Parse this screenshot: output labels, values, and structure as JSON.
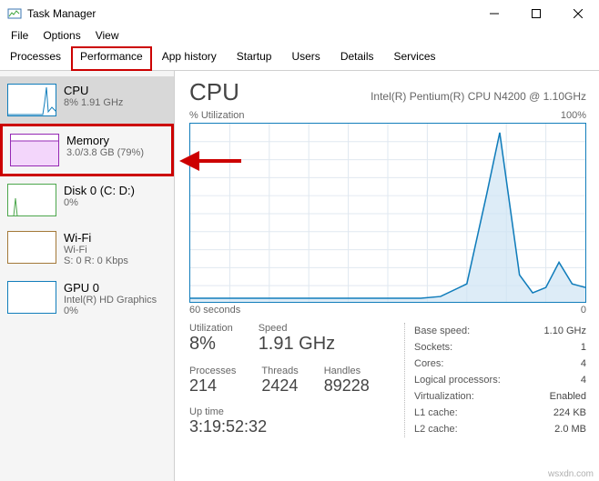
{
  "window": {
    "title": "Task Manager"
  },
  "menu": {
    "file": "File",
    "options": "Options",
    "view": "View"
  },
  "tabs": {
    "processes": "Processes",
    "performance": "Performance",
    "app_history": "App history",
    "startup": "Startup",
    "users": "Users",
    "details": "Details",
    "services": "Services"
  },
  "sidebar": {
    "cpu": {
      "name": "CPU",
      "sub": "8% 1.91 GHz"
    },
    "memory": {
      "name": "Memory",
      "sub": "3.0/3.8 GB (79%)"
    },
    "disk": {
      "name": "Disk 0 (C: D:)",
      "sub": "0%"
    },
    "wifi": {
      "name": "Wi-Fi",
      "sub1": "Wi-Fi",
      "sub2": "S: 0 R: 0 Kbps"
    },
    "gpu": {
      "name": "GPU 0",
      "sub1": "Intel(R) HD Graphics",
      "sub2": "0%"
    }
  },
  "main": {
    "title": "CPU",
    "device": "Intel(R) Pentium(R) CPU N4200 @ 1.10GHz",
    "chart_left": "% Utilization",
    "chart_right": "100%",
    "chart_bl": "60 seconds",
    "chart_br": "0",
    "utilization": {
      "label": "Utilization",
      "value": "8%"
    },
    "speed": {
      "label": "Speed",
      "value": "1.91 GHz"
    },
    "processes": {
      "label": "Processes",
      "value": "214"
    },
    "threads": {
      "label": "Threads",
      "value": "2424"
    },
    "handles": {
      "label": "Handles",
      "value": "89228"
    },
    "uptime": {
      "label": "Up time",
      "value": "3:19:52:32"
    },
    "base_speed": {
      "label": "Base speed:",
      "value": "1.10 GHz"
    },
    "sockets": {
      "label": "Sockets:",
      "value": "1"
    },
    "cores": {
      "label": "Cores:",
      "value": "4"
    },
    "logical": {
      "label": "Logical processors:",
      "value": "4"
    },
    "virtualization": {
      "label": "Virtualization:",
      "value": "Enabled"
    },
    "l1": {
      "label": "L1 cache:",
      "value": "224 KB"
    },
    "l2": {
      "label": "L2 cache:",
      "value": "2.0 MB"
    }
  },
  "chart_data": {
    "type": "line",
    "title": "% Utilization",
    "xlabel": "60 seconds",
    "ylabel": "% Utilization",
    "ylim": [
      0,
      100
    ],
    "x_seconds_ago": [
      60,
      55,
      50,
      45,
      40,
      35,
      30,
      25,
      20,
      18,
      15,
      13,
      10,
      8,
      6,
      4,
      2,
      0
    ],
    "values": [
      2,
      2,
      2,
      2,
      2,
      2,
      2,
      2,
      3,
      10,
      60,
      95,
      15,
      5,
      8,
      22,
      10,
      8
    ]
  },
  "watermark": "wsxdn.com"
}
